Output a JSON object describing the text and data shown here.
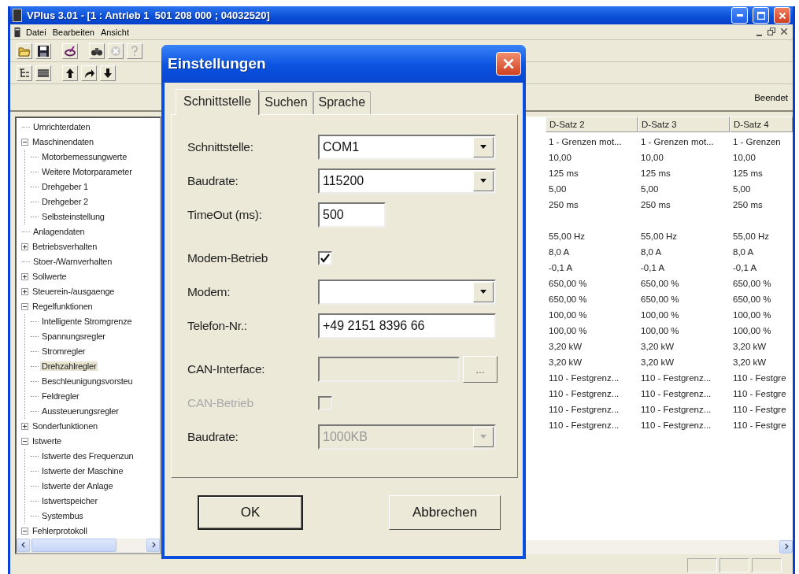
{
  "window": {
    "title": "VPlus 3.01 - [1 : Antrieb 1  501 208 000 ; 04032520]"
  },
  "menu": [
    "Datei",
    "Bearbeiten",
    "Ansicht"
  ],
  "status_strip": "Beendet",
  "tree": [
    {
      "label": "Umrichterdaten",
      "selected": false
    },
    {
      "label": "Maschinendaten",
      "selected": false,
      "expanded": true,
      "children": [
        {
          "label": "Motorbemessungwerte",
          "selected": false
        },
        {
          "label": "Weitere Motorparameter",
          "selected": false
        },
        {
          "label": "Drehgeber 1",
          "selected": false
        },
        {
          "label": "Drehgeber 2",
          "selected": false
        },
        {
          "label": "Selbsteinstellung",
          "selected": false
        }
      ]
    },
    {
      "label": "Anlagendaten",
      "selected": false
    },
    {
      "label": "Betriebsverhalten",
      "selected": false,
      "expanded": false
    },
    {
      "label": "Stoer-/Warnverhalten",
      "selected": false
    },
    {
      "label": "Sollwerte",
      "selected": false,
      "expanded": false
    },
    {
      "label": "Steuerein-/ausgaenge",
      "selected": false,
      "expanded": false
    },
    {
      "label": "Regelfunktionen",
      "selected": false,
      "expanded": true,
      "children": [
        {
          "label": "Intelligente Stromgrenze",
          "selected": false
        },
        {
          "label": "Spannungsregler",
          "selected": false
        },
        {
          "label": "Stromregler",
          "selected": false
        },
        {
          "label": "Drehzahlregler",
          "selected": true
        },
        {
          "label": "Beschleunigungsvorsteu",
          "selected": false
        },
        {
          "label": "Feldregler",
          "selected": false
        },
        {
          "label": "Aussteuerungsregler",
          "selected": false
        }
      ]
    },
    {
      "label": "Sonderfunktionen",
      "selected": false,
      "expanded": false
    },
    {
      "label": "Istwerte",
      "selected": false,
      "expanded": true,
      "children": [
        {
          "label": "Istwerte des Frequenzun",
          "selected": false
        },
        {
          "label": "Istwerte der Maschine",
          "selected": false
        },
        {
          "label": "Istwerte der Anlage",
          "selected": false
        },
        {
          "label": "Istwertspeicher",
          "selected": false
        },
        {
          "label": "Systembus",
          "selected": false
        }
      ]
    },
    {
      "label": "Fehlerprotokoll",
      "selected": false,
      "expanded": true
    }
  ],
  "grid": {
    "columns": [
      "D-Satz 2",
      "D-Satz 3",
      "D-Satz 4"
    ],
    "rows": [
      {
        "cells": [
          "1 - Grenzen mot...",
          "1 - Grenzen mot...",
          "1 - Grenzen"
        ],
        "spaced": false
      },
      {
        "cells": [
          "10,00",
          "10,00",
          "10,00"
        ],
        "spaced": false
      },
      {
        "cells": [
          "125 ms",
          "125 ms",
          "125 ms"
        ],
        "spaced": false
      },
      {
        "cells": [
          "5,00",
          "5,00",
          "5,00"
        ],
        "spaced": false
      },
      {
        "cells": [
          "250 ms",
          "250 ms",
          "250 ms"
        ],
        "spaced": false
      },
      {
        "cells": [
          "55,00 Hz",
          "55,00 Hz",
          "55,00 Hz"
        ],
        "spaced": true
      },
      {
        "cells": [
          "8,0 A",
          "8,0 A",
          "8,0 A"
        ],
        "spaced": false
      },
      {
        "cells": [
          "-0,1 A",
          "-0,1 A",
          "-0,1 A"
        ],
        "spaced": false
      },
      {
        "cells": [
          "650,00 %",
          "650,00 %",
          "650,00 %"
        ],
        "spaced": false
      },
      {
        "cells": [
          "650,00 %",
          "650,00 %",
          "650,00 %"
        ],
        "spaced": false
      },
      {
        "cells": [
          "100,00 %",
          "100,00 %",
          "100,00 %"
        ],
        "spaced": false
      },
      {
        "cells": [
          "100,00 %",
          "100,00 %",
          "100,00 %"
        ],
        "spaced": false
      },
      {
        "cells": [
          "3,20 kW",
          "3,20 kW",
          "3,20 kW"
        ],
        "spaced": false
      },
      {
        "cells": [
          "3,20 kW",
          "3,20 kW",
          "3,20 kW"
        ],
        "spaced": false
      },
      {
        "cells": [
          "110 - Festgrenz...",
          "110 - Festgrenz...",
          "110 - Festgre"
        ],
        "spaced": false
      },
      {
        "cells": [
          "110 - Festgrenz...",
          "110 - Festgrenz...",
          "110 - Festgre"
        ],
        "spaced": false
      },
      {
        "cells": [
          "110 - Festgrenz...",
          "110 - Festgrenz...",
          "110 - Festgre"
        ],
        "spaced": false
      },
      {
        "cells": [
          "110 - Festgrenz...",
          "110 - Festgrenz...",
          "110 - Festgre"
        ],
        "spaced": false
      }
    ]
  },
  "dialog": {
    "title": "Einstellungen",
    "tabs": [
      {
        "label": "Schnittstelle",
        "selected": true
      },
      {
        "label": "Suchen",
        "selected": false
      },
      {
        "label": "Sprache",
        "selected": false
      }
    ],
    "groups": [
      [
        {
          "label": "Schnittstelle:",
          "kind": "select",
          "value": "COM1",
          "disabled": false
        },
        {
          "label": "Baudrate:",
          "kind": "select",
          "value": "115200",
          "disabled": false
        },
        {
          "label": "TimeOut (ms):",
          "kind": "number",
          "value": "500",
          "disabled": false
        }
      ],
      [
        {
          "label": "Modem-Betrieb",
          "kind": "checkbox",
          "checked": true,
          "disabled": false
        },
        {
          "label": "Modem:",
          "kind": "select",
          "disabled": false
        },
        {
          "label": "Telefon-Nr.:",
          "kind": "text",
          "value": "+49 2151 8396 66",
          "disabled": false
        }
      ],
      [
        {
          "label": "CAN-Interface:",
          "kind": "browse",
          "button": "...",
          "disabled": true
        },
        {
          "label": "CAN-Betrieb",
          "kind": "checkbox",
          "checked": false,
          "disabled": true
        },
        {
          "label": "Baudrate:",
          "kind": "select",
          "value": "1000KB",
          "disabled": true
        }
      ]
    ],
    "buttons": [
      {
        "label": "OK",
        "default": true
      },
      {
        "label": "Abbrechen",
        "default": false
      }
    ]
  }
}
